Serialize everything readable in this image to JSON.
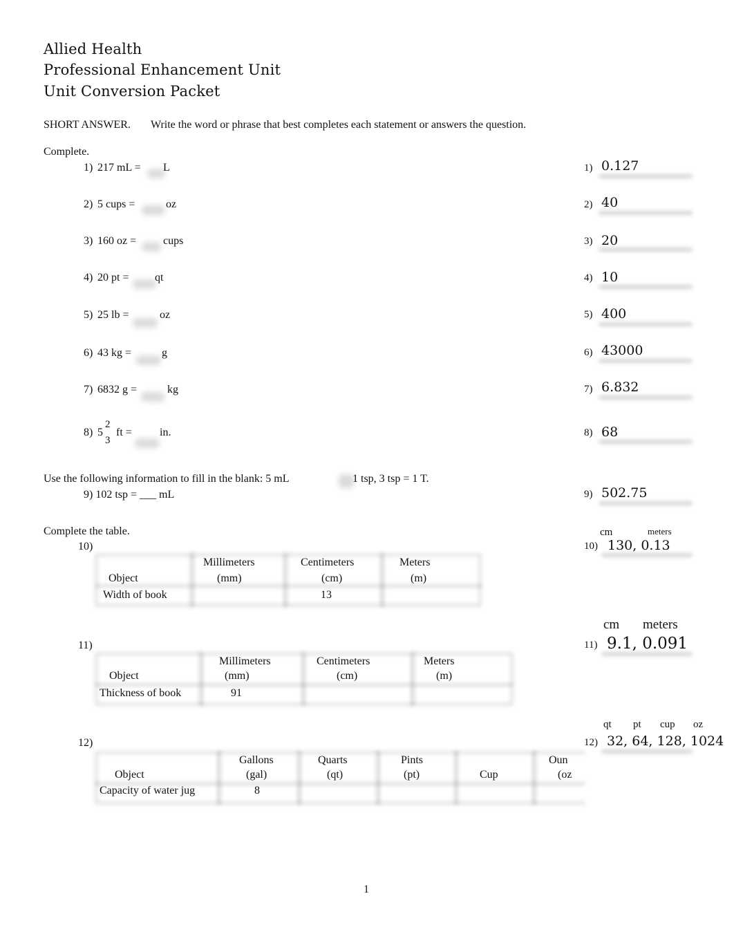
{
  "header": {
    "line1": "Allied Health",
    "line2": "Professional Enhancement Unit",
    "line3": "Unit Conversion Packet"
  },
  "instructions": {
    "section": "SHORT ANSWER.",
    "text": "Write the word or phrase that best completes each statement or answers the question."
  },
  "complete_label": "Complete.",
  "questions": [
    {
      "num": "1)",
      "lhs": "217 mL  =",
      "unit": "L"
    },
    {
      "num": "2)",
      "lhs": "5 cups  =",
      "unit": "oz"
    },
    {
      "num": "3)",
      "lhs": "160 oz =",
      "unit": "cups"
    },
    {
      "num": "4)",
      "lhs": "20 pt  =",
      "unit": "qt"
    },
    {
      "num": "5)",
      "lhs": "25 lb =",
      "unit": "oz"
    },
    {
      "num": "6)",
      "lhs": "43 kg =",
      "unit": "g"
    },
    {
      "num": "7)",
      "lhs": "6832 g =",
      "unit": "kg"
    },
    {
      "num": "8)",
      "whole": "5",
      "numerator": "2",
      "denominator": "3",
      "lhs_rest": "ft  =",
      "unit": "in."
    }
  ],
  "info": {
    "text": "Use the following information to fill in the blank: 5 mL",
    "rest": "1 tsp,   3 tsp  = 1 T.",
    "q9": "9) 102 tsp  = ___ mL"
  },
  "table_label": "Complete the table.",
  "tables": [
    {
      "num": "10)",
      "headers": [
        [
          "",
          "Object"
        ],
        [
          "Millimeters",
          "(mm)"
        ],
        [
          "Centimeters",
          "(cm)"
        ],
        [
          "Meters",
          "(m)"
        ]
      ],
      "row": [
        "Width of book",
        "",
        "13",
        ""
      ]
    },
    {
      "num": "11)",
      "headers": [
        [
          "",
          "Object"
        ],
        [
          "Millimeters",
          "(mm)"
        ],
        [
          "Centimeters",
          "(cm)"
        ],
        [
          "Meters",
          "(m)"
        ]
      ],
      "row": [
        "Thickness of book",
        "91",
        "",
        ""
      ]
    },
    {
      "num": "12)",
      "headers": [
        [
          "",
          "Object"
        ],
        [
          "Gallons",
          "(gal)"
        ],
        [
          "Quarts",
          "(qt)"
        ],
        [
          "Pints",
          "(pt)"
        ],
        [
          "",
          "Cup"
        ],
        [
          "Oun",
          "(oz"
        ]
      ],
      "row": [
        "Capacity of water jug",
        "8",
        "",
        "",
        "",
        ""
      ]
    }
  ],
  "answers": [
    {
      "num": "1)",
      "value": "0.127"
    },
    {
      "num": "2)",
      "value": "40"
    },
    {
      "num": "3)",
      "value": "20"
    },
    {
      "num": "4)",
      "value": "10"
    },
    {
      "num": "5)",
      "value": "400"
    },
    {
      "num": "6)",
      "value": "43000"
    },
    {
      "num": "7)",
      "value": "6.832"
    },
    {
      "num": "8)",
      "value": "68"
    },
    {
      "num": "9)",
      "value": "502.75"
    },
    {
      "num": "10)",
      "value": "130, 0.13",
      "labels": [
        "cm",
        "meters"
      ]
    },
    {
      "num": "11)",
      "value": "9.1, 0.091",
      "labels": [
        "cm",
        "meters"
      ]
    },
    {
      "num": "12)",
      "value": "32, 64, 128, 1024",
      "labels": [
        "qt",
        "pt",
        "cup",
        "oz"
      ]
    }
  ],
  "footer": {
    "page_number": "1"
  }
}
